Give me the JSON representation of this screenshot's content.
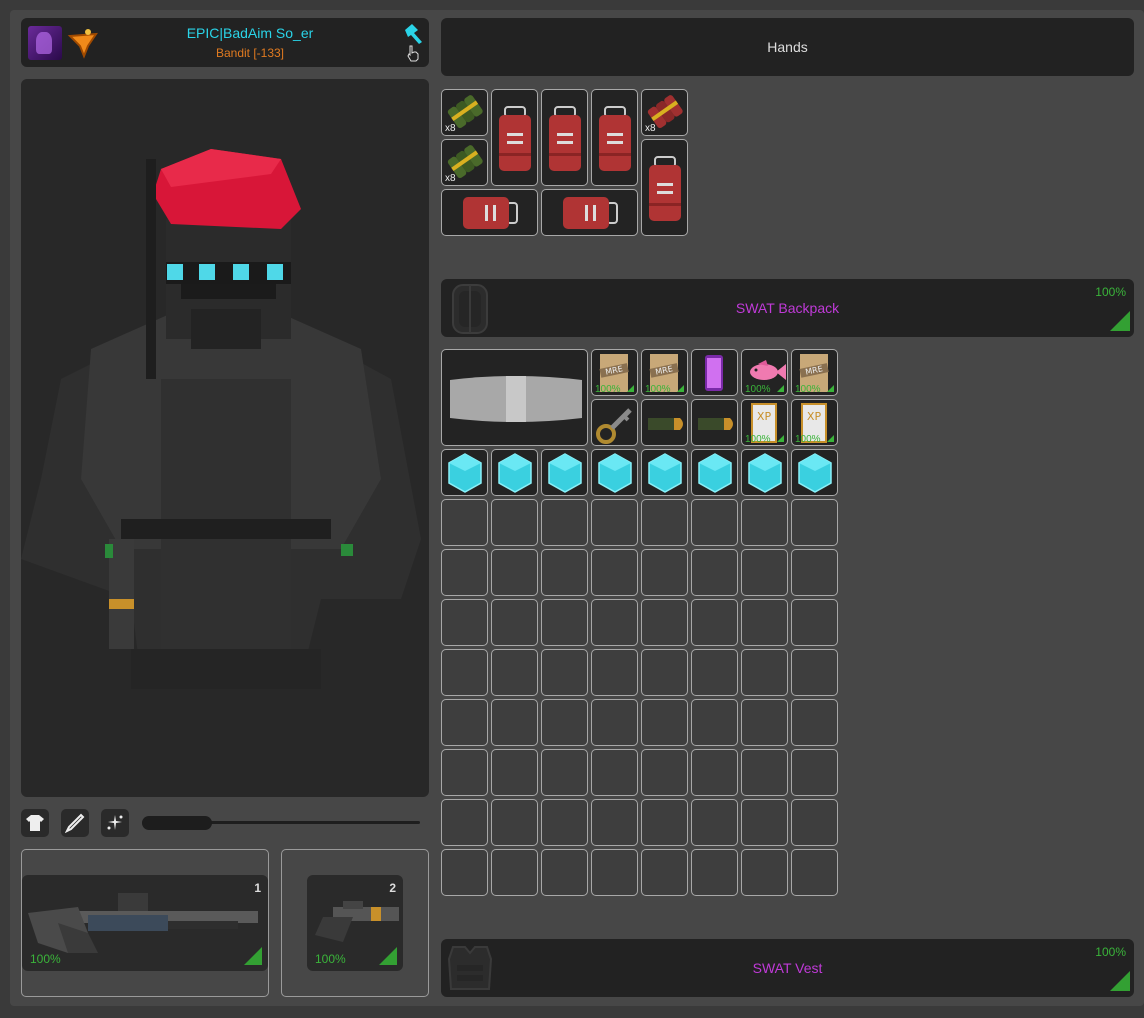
{
  "player": {
    "name": "EPIC|BadAim So_er",
    "rank": "Bandit [-133]",
    "icons": [
      "avatar-icon",
      "clan-icon",
      "hammer-icon",
      "cursor-icon"
    ]
  },
  "toolbar": {
    "buttons": [
      "clothing-icon",
      "weapon-icon",
      "sparkle-icon"
    ],
    "zoom_slider_value": 0.25
  },
  "weapons": [
    {
      "slot": "1",
      "durability": "100%",
      "icon": "shotgun-icon"
    },
    {
      "slot": "2",
      "durability": "100%",
      "icon": "pistol-icon"
    }
  ],
  "hands": {
    "label": "Hands"
  },
  "hands_items": [
    {
      "icon": "grenade-bundle-icon",
      "count": "x8"
    },
    {
      "icon": "red-backpack-icon",
      "count": ""
    },
    {
      "icon": "red-backpack-icon",
      "count": ""
    },
    {
      "icon": "red-backpack-icon",
      "count": ""
    },
    {
      "icon": "dynamite-bundle-icon",
      "count": "x8"
    },
    {
      "icon": "grenade-bundle-icon",
      "count": "x8"
    },
    {
      "icon": "red-backpack-icon",
      "count": ""
    },
    {
      "icon": "red-backpack-h-icon",
      "count": ""
    },
    {
      "icon": "red-backpack-h-icon",
      "count": ""
    }
  ],
  "backpack": {
    "name": "SWAT Backpack",
    "durability": "100%",
    "icon": "backpack-icon"
  },
  "backpack_items": [
    {
      "icon": "mre-icon",
      "durability": "100%"
    },
    {
      "icon": "mre-icon",
      "durability": "100%"
    },
    {
      "icon": "phone-icon",
      "durability": ""
    },
    {
      "icon": "fish-icon",
      "durability": "100%"
    },
    {
      "icon": "mre-icon",
      "durability": "100%"
    },
    {
      "icon": "key-icon",
      "durability": ""
    },
    {
      "icon": "bullet-icon",
      "durability": ""
    },
    {
      "icon": "bullet-icon",
      "durability": ""
    },
    {
      "icon": "xp-book-icon",
      "durability": "100%"
    },
    {
      "icon": "xp-book-icon",
      "durability": "100%"
    }
  ],
  "backpack_big_item": {
    "icon": "barrel-sight-icon"
  },
  "crystals": {
    "icon": "crystal-icon",
    "count": 8
  },
  "vest": {
    "name": "SWAT Vest",
    "durability": "100%",
    "icon": "vest-icon"
  },
  "colors": {
    "accent_cyan": "#2ad4e8",
    "rank_orange": "#e07a20",
    "item_purple": "#c03ad8",
    "durability_green": "#3ab43a"
  }
}
